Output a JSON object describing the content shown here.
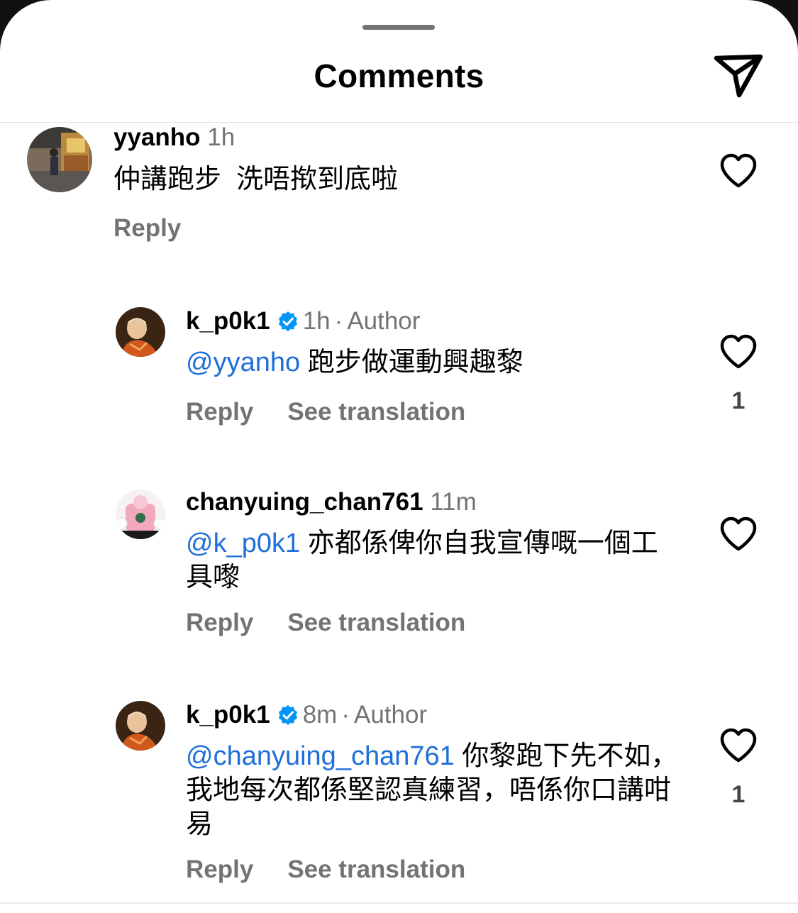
{
  "header": {
    "title": "Comments"
  },
  "comments": [
    {
      "username": "yyanho",
      "time": "1h",
      "text": "仲講跑步  洗唔揿到底啦",
      "reply_label": "Reply"
    },
    {
      "username": "k_p0k1",
      "time": "1h",
      "separator": "·",
      "author_label": "Author",
      "mention": "@yyanho",
      "text": "跑步做運動興趣黎",
      "reply_label": "Reply",
      "translate_label": "See translation",
      "like_count": "1"
    },
    {
      "username": "chanyuing_chan761",
      "time": "11m",
      "mention": "@k_p0k1",
      "text": "亦都係俾你自我宣傳嘅一個工具嚟",
      "reply_label": "Reply",
      "translate_label": "See translation"
    },
    {
      "username": "k_p0k1",
      "time": "8m",
      "separator": "·",
      "author_label": "Author",
      "mention": "@chanyuing_chan761",
      "text": "你黎跑下先不如，我地每次都係堅認真練習，唔係你口講咁易",
      "reply_label": "Reply",
      "translate_label": "See translation",
      "like_count": "1"
    }
  ],
  "icons": {
    "share": "paper-plane-icon",
    "like": "heart-outline-icon",
    "verified": "verified-badge-icon"
  },
  "colors": {
    "mention": "#1e6fd9",
    "verified": "#0095f6",
    "secondary_text": "#737373"
  }
}
